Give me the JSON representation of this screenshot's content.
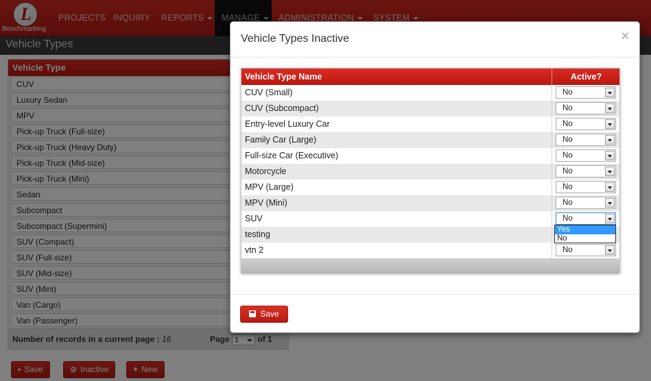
{
  "nav": {
    "logo_letter": "L",
    "logo_text": "Benchmarking",
    "items": [
      "PROJECTS",
      "INQUIRY",
      "REPORTS",
      "MANAGE",
      "ADMINISTRATION",
      "SYSTEM"
    ]
  },
  "page": {
    "title": "Vehicle Types"
  },
  "list": {
    "header": "Vehicle Type",
    "rows": [
      "CUV",
      "Luxury Sedan",
      "MPV",
      "Pick-up Truck (Full-size)",
      "Pick-up Truck (Heavy Duty)",
      "Pick-up Truck (Mid-size)",
      "Pick-up Truck (Mini)",
      "Sedan",
      "Subcompact",
      "Subcompact (Supermini)",
      "SUV (Compact)",
      "SUV (Full-size)",
      "SUV (Mid-size)",
      "SUV (Mini)",
      "Van (Cargo)",
      "Van (Passenger)"
    ],
    "footer_label": "Number of records in a current page :",
    "footer_count": "16",
    "page_label": "Page",
    "page_value": "1",
    "of_label": "of 1"
  },
  "buttons": {
    "save": "Save",
    "inactive": "Inactive",
    "new": "New"
  },
  "modal": {
    "title": "Vehicle Types Inactive",
    "close": "×",
    "col_name": "Vehicle Type Name",
    "col_active": "Active?",
    "rows": [
      {
        "name": "CUV (Small)",
        "active": "No"
      },
      {
        "name": "CUV (Subcompact)",
        "active": "No"
      },
      {
        "name": "Entry-level Luxury Car",
        "active": "No"
      },
      {
        "name": "Family Car (Large)",
        "active": "No"
      },
      {
        "name": "Full-size Car (Executive)",
        "active": "No"
      },
      {
        "name": "Motorcycle",
        "active": "No"
      },
      {
        "name": "MPV (Large)",
        "active": "No"
      },
      {
        "name": "MPV (Mini)",
        "active": "No"
      },
      {
        "name": "SUV",
        "active": "No"
      },
      {
        "name": "testing",
        "active": ""
      },
      {
        "name": "vtn 2",
        "active": "No"
      }
    ],
    "dropdown_options": [
      "Yes",
      "No"
    ],
    "save": "Save"
  },
  "colors": {
    "brand_red": "#c8221a",
    "highlight": "#3399ff"
  }
}
